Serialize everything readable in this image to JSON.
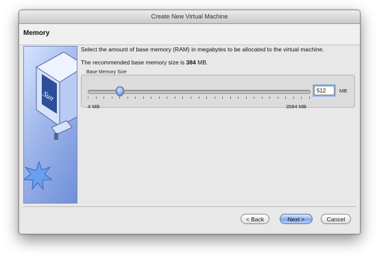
{
  "window": {
    "title": "Create New Virtual Machine"
  },
  "page": {
    "heading": "Memory"
  },
  "content": {
    "description": "Select the amount of base memory (RAM) in megabytes to be allocated to the virtual machine.",
    "recommended_prefix": "The recommended base memory size is",
    "recommended_value": "384",
    "recommended_suffix": "MB."
  },
  "memory": {
    "group_label": "Base Memory Size",
    "value": "512",
    "unit": "MB",
    "min_label": "4 MB",
    "max_label": "3584 MB",
    "min_mb": 4,
    "max_mb": 3584,
    "slider_value_mb": 512
  },
  "buttons": {
    "back": "< Back",
    "next": "Next >",
    "cancel": "Cancel"
  },
  "sidebar": {
    "logo_text": "Sun"
  },
  "colors": {
    "accent": "#7aa2e9",
    "sidebar": "#9fb6ea"
  },
  "icons": [
    "virtualbox-cube-icon",
    "sun-logo-icon",
    "starburst-icon"
  ]
}
